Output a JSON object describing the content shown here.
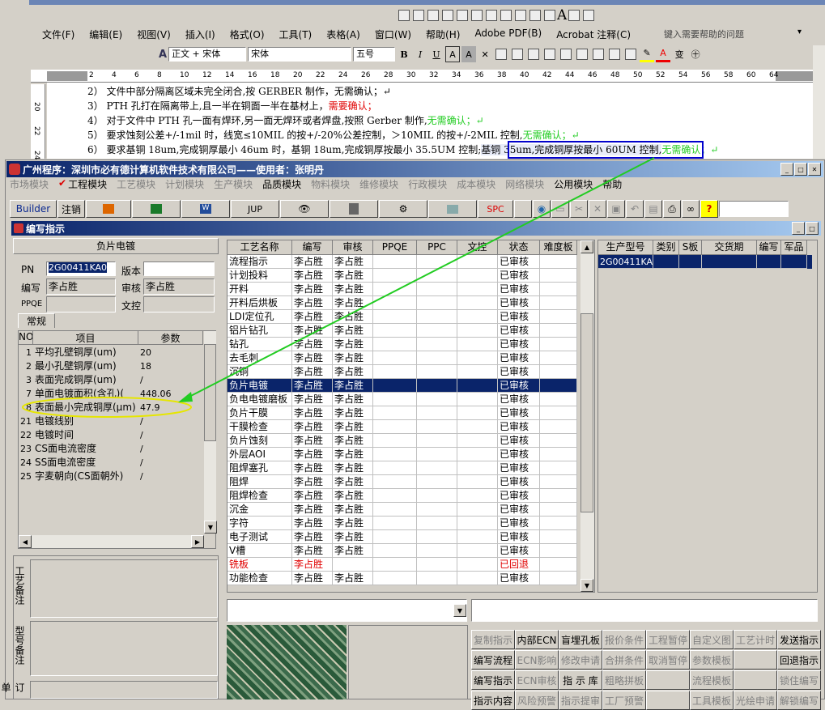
{
  "word": {
    "menu": [
      "文件(F)",
      "编辑(E)",
      "视图(V)",
      "插入(I)",
      "格式(O)",
      "工具(T)",
      "表格(A)",
      "窗口(W)",
      "帮助(H)",
      "Adobe PDF(B)",
      "Acrobat 注释(C)"
    ],
    "help_placeholder": "键入需要帮助的问题",
    "style": "正文 + 宋体",
    "font": "宋体",
    "size": "五号",
    "ruler": [
      "2",
      "4",
      "6",
      "8",
      "10",
      "12",
      "14",
      "16",
      "18",
      "20",
      "22",
      "24",
      "26",
      "28",
      "30",
      "32",
      "34",
      "36",
      "38",
      "40",
      "42",
      "44",
      "46",
      "48",
      "50",
      "52",
      "54",
      "56",
      "58",
      "60",
      "64"
    ],
    "left_ruler": [
      "20",
      "22",
      "24"
    ],
    "doc_lines": [
      {
        "a": "2） 文件中部分隔离区域未完全闭合,按 GERBER 制作，无需确认；↵",
        "r": "",
        "g": ""
      },
      {
        "a": "3） PTH 孔打在隔离带上,且一半在铜面一半在基材上，",
        "r": "需要确认；",
        "g": ""
      },
      {
        "a": "4） 对于文件中 PTH 孔一面有焊环,另一面无焊环或者焊盘,按照 Gerber 制作,",
        "r": "",
        "g": "无需确认；↵"
      },
      {
        "a": "5） 要求蚀刻公差+/-1mil 时，线宽≤10MIL 的按+/-20%公差控制，＞10MIL 的按+/-2MIL 控制,",
        "r": "",
        "g": "无需确认；↵"
      },
      {
        "a": "6） 要求基铜 18um,完成铜厚最小 46um 时，基铜 18um,完成铜厚按最小 35.5UM 控制;",
        "box": "基铜 35um,完成铜厚按最小 60UM 控制,",
        "g": "无需确认；↵"
      }
    ]
  },
  "app": {
    "title": "广州程序：深圳市必有德计算机软件技术有限公司——使用者：张明丹",
    "menu": [
      {
        "t": "市场模块",
        "d": true
      },
      {
        "t": "工程模块",
        "d": false
      },
      {
        "t": "工艺模块",
        "d": true
      },
      {
        "t": "计划模块",
        "d": true
      },
      {
        "t": "生产模块",
        "d": true
      },
      {
        "t": "品质模块",
        "d": false
      },
      {
        "t": "物料模块",
        "d": true
      },
      {
        "t": "维修模块",
        "d": true
      },
      {
        "t": "行政模块",
        "d": true
      },
      {
        "t": "成本模块",
        "d": true
      },
      {
        "t": "网络模块",
        "d": true
      },
      {
        "t": "公用模块",
        "d": false
      },
      {
        "t": "帮助",
        "d": false
      }
    ],
    "toolbar": {
      "builder": "Builder",
      "cancel": "注销",
      "jup": "JUP",
      "spc": "SPC"
    }
  },
  "win": {
    "title": "编写指示",
    "section": "负片电镀",
    "pn_label": "PN",
    "pn": "2G00411KA0",
    "version_label": "版本",
    "version": "",
    "writer_label": "编写",
    "writer": "李占胜",
    "auditor_label": "审核",
    "auditor": "李占胜",
    "ppqe_label": "PPQE",
    "ppqe": "",
    "doc_label": "文控",
    "doc": "",
    "tab": "常规",
    "params_headers": [
      "NO",
      "项目",
      "参数"
    ],
    "params": [
      {
        "no": "1",
        "item": "平均孔壁铜厚(um)",
        "val": "20"
      },
      {
        "no": "2",
        "item": "最小孔壁铜厚(um)",
        "val": "18"
      },
      {
        "no": "3",
        "item": "表面完成铜厚(um)",
        "val": "/"
      },
      {
        "no": "7",
        "item": "单面电镀面积(含孔)(",
        "val": "448.06"
      },
      {
        "no": "8",
        "item": "表面最小完成铜厚(μm)",
        "val": "47.9"
      },
      {
        "no": "21",
        "item": "电镀线别",
        "val": "/"
      },
      {
        "no": "22",
        "item": "电镀时间",
        "val": "/"
      },
      {
        "no": "23",
        "item": "CS面电流密度",
        "val": "/"
      },
      {
        "no": "24",
        "item": "SS面电流密度",
        "val": "/"
      },
      {
        "no": "25",
        "item": "字麦朝向(CS面朝外)",
        "val": "/"
      }
    ],
    "note_labels": [
      "工艺备注",
      "型号备注",
      "订单"
    ],
    "proc_headers": [
      "工艺名称",
      "编写",
      "审核",
      "PPQE",
      "PPC",
      "文控",
      "状态",
      "难度板"
    ],
    "proc_rows": [
      [
        "流程指示",
        "李占胜",
        "李占胜",
        "已审核"
      ],
      [
        "计划投料",
        "李占胜",
        "李占胜",
        "已审核"
      ],
      [
        "开料",
        "李占胜",
        "李占胜",
        "已审核"
      ],
      [
        "开料后烘板",
        "李占胜",
        "李占胜",
        "已审核"
      ],
      [
        "LDI定位孔",
        "李占胜",
        "李占胜",
        "已审核"
      ],
      [
        "铝片钻孔",
        "李占胜",
        "李占胜",
        "已审核"
      ],
      [
        "钻孔",
        "李占胜",
        "李占胜",
        "已审核"
      ],
      [
        "去毛刺",
        "李占胜",
        "李占胜",
        "已审核"
      ],
      [
        "沉铜",
        "李占胜",
        "李占胜",
        "已审核"
      ],
      [
        "负片电镀",
        "李占胜",
        "李占胜",
        "已审核"
      ],
      [
        "负电电镀磨板",
        "李占胜",
        "李占胜",
        "已审核"
      ],
      [
        "负片干膜",
        "李占胜",
        "李占胜",
        "已审核"
      ],
      [
        "干膜检查",
        "李占胜",
        "李占胜",
        "已审核"
      ],
      [
        "负片蚀刻",
        "李占胜",
        "李占胜",
        "已审核"
      ],
      [
        "外层AOI",
        "李占胜",
        "李占胜",
        "已审核"
      ],
      [
        "阻焊塞孔",
        "李占胜",
        "李占胜",
        "已审核"
      ],
      [
        "阻焊",
        "李占胜",
        "李占胜",
        "已审核"
      ],
      [
        "阻焊检查",
        "李占胜",
        "李占胜",
        "已审核"
      ],
      [
        "沉金",
        "李占胜",
        "李占胜",
        "已审核"
      ],
      [
        "字符",
        "李占胜",
        "李占胜",
        "已审核"
      ],
      [
        "电子测试",
        "李占胜",
        "李占胜",
        "已审核"
      ],
      [
        "V槽",
        "李占胜",
        "李占胜",
        "已审核"
      ],
      [
        "铣板",
        "李占胜",
        "",
        "已回退"
      ],
      [
        "功能检查",
        "李占胜",
        "李占胜",
        "已审核"
      ]
    ],
    "prod_headers": [
      "生产型号",
      "类别",
      "S板",
      "交货期",
      "编写",
      "军品"
    ],
    "prod_rows": [
      [
        "2G00411KA0",
        "",
        "",
        "",
        "",
        ""
      ]
    ],
    "buttons": [
      [
        {
          "t": "复制指示",
          "d": true
        },
        {
          "t": "内部ECN",
          "d": false
        },
        {
          "t": "盲埋孔板",
          "d": false
        },
        {
          "t": "报价条件",
          "d": true
        },
        {
          "t": "工程暂停",
          "d": true
        },
        {
          "t": "自定义图",
          "d": true
        },
        {
          "t": "工艺计时",
          "d": true
        },
        {
          "t": "发送指示",
          "d": false
        }
      ],
      [
        {
          "t": "编写流程",
          "d": false
        },
        {
          "t": "ECN影响",
          "d": true
        },
        {
          "t": "修改申请",
          "d": true
        },
        {
          "t": "合拼条件",
          "d": true
        },
        {
          "t": "取消暂停",
          "d": true
        },
        {
          "t": "参数模板",
          "d": true
        },
        {
          "t": "",
          "d": true
        },
        {
          "t": "回退指示",
          "d": false
        }
      ],
      [
        {
          "t": "编写指示",
          "d": false
        },
        {
          "t": "ECN审核",
          "d": true
        },
        {
          "t": "指 示 库",
          "d": false
        },
        {
          "t": "粗略拼板",
          "d": true
        },
        {
          "t": "",
          "d": true
        },
        {
          "t": "流程模板",
          "d": true
        },
        {
          "t": "",
          "d": true
        },
        {
          "t": "锁住编写",
          "d": true
        }
      ],
      [
        {
          "t": "指示内容",
          "d": false
        },
        {
          "t": "风险预警",
          "d": true
        },
        {
          "t": "指示提审",
          "d": true
        },
        {
          "t": "工厂预警",
          "d": true
        },
        {
          "t": "",
          "d": true
        },
        {
          "t": "工具模板",
          "d": true
        },
        {
          "t": "光绘申请",
          "d": true
        },
        {
          "t": "解锁编写",
          "d": true
        }
      ]
    ]
  },
  "colors": {
    "highlight": "#0a246a",
    "annotation": "#22cc22",
    "ellipse": "#e6e600",
    "box": "#0000cc"
  }
}
